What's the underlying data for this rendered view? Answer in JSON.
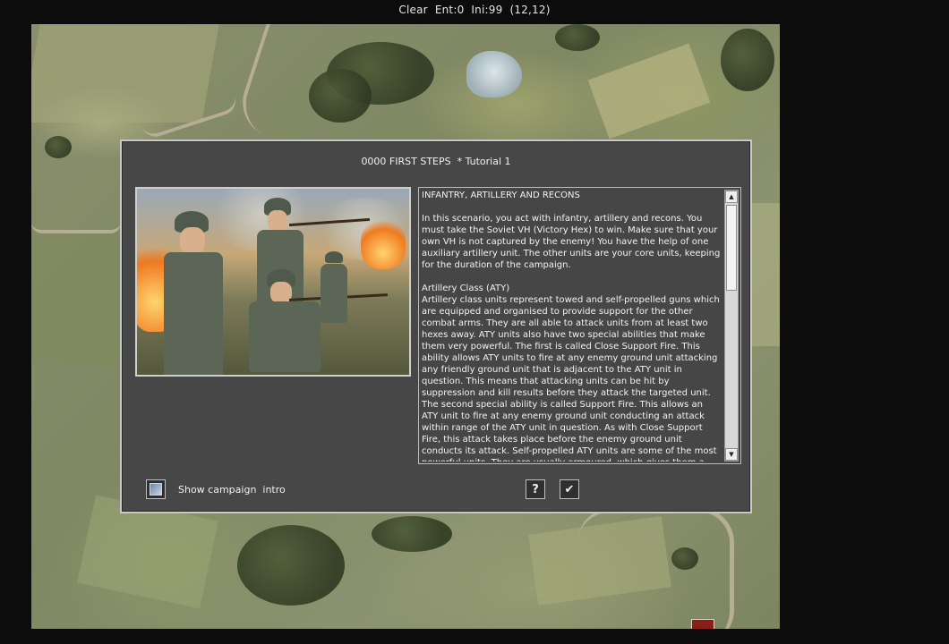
{
  "status_bar": {
    "text": "Clear  Ent:0  Ini:99  (12,12)"
  },
  "dialog": {
    "title": "0000 FIRST STEPS  * Tutorial 1",
    "paragraphs": [
      "INFANTRY, ARTILLERY AND RECONS",
      "In this scenario, you act with infantry, artillery and recons. You must take the Soviet VH (Victory Hex) to win. Make sure that your own VH is not captured by the enemy! You have the help of one auxiliary artillery unit. The other units are your core units, keeping for the duration of the campaign.",
      "Artillery Class (ATY)\nArtillery class units represent towed and self-propelled guns which are equipped and organised to provide support for the other combat arms. They are all able to attack units from at least two hexes away. ATY units also have two special abilities that make them very powerful. The first is called Close Support Fire. This ability allows ATY units to fire at any enemy ground unit attacking any friendly ground unit that is adjacent to the ATY unit in question. This means that attacking units can be hit by suppression and kill results before they attack the targeted unit. The second special ability is called Support Fire. This allows an ATY unit to fire at any enemy ground unit conducting an attack within range of the ATY unit in question. As with Close Support Fire, this attack takes place before the enemy ground unit conducts its attack. Self-propelled ATY units are some of the most powerful units. They are usually armoured, which gives them a large advant age in an"
    ],
    "scroll": {
      "up_icon": "arrow-up-icon",
      "down_icon": "arrow-down-icon"
    },
    "campaign_intro_label": "Show campaign  intro",
    "help_label": "?",
    "confirm_label": "✔"
  }
}
